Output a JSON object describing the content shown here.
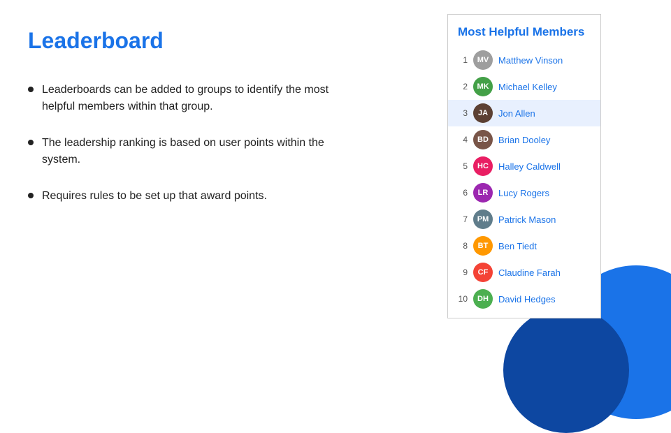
{
  "title": "Leaderboard",
  "bullets": [
    "Leaderboards can be added to groups to identify the most helpful members within that group.",
    "The leadership ranking is based on user points within the system.",
    "Requires rules to be set up that award points."
  ],
  "leaderboard": {
    "title": "Most Helpful Members",
    "members": [
      {
        "rank": 1,
        "name": "Matthew Vinson",
        "avClass": "av-1",
        "initials": "MV",
        "highlighted": false
      },
      {
        "rank": 2,
        "name": "Michael Kelley",
        "avClass": "av-2",
        "initials": "MK",
        "highlighted": false
      },
      {
        "rank": 3,
        "name": "Jon Allen",
        "avClass": "av-3",
        "initials": "JA",
        "highlighted": true
      },
      {
        "rank": 4,
        "name": "Brian Dooley",
        "avClass": "av-4",
        "initials": "BD",
        "highlighted": false
      },
      {
        "rank": 5,
        "name": "Halley Caldwell",
        "avClass": "av-5",
        "initials": "HC",
        "highlighted": false
      },
      {
        "rank": 6,
        "name": "Lucy Rogers",
        "avClass": "av-6",
        "initials": "LR",
        "highlighted": false
      },
      {
        "rank": 7,
        "name": "Patrick Mason",
        "avClass": "av-7",
        "initials": "PM",
        "highlighted": false
      },
      {
        "rank": 8,
        "name": "Ben Tiedt",
        "avClass": "av-8",
        "initials": "BT",
        "highlighted": false
      },
      {
        "rank": 9,
        "name": "Claudine Farah",
        "avClass": "av-9",
        "initials": "CF",
        "highlighted": false
      },
      {
        "rank": 10,
        "name": "David Hedges",
        "avClass": "av-10",
        "initials": "DH",
        "highlighted": false
      }
    ]
  }
}
